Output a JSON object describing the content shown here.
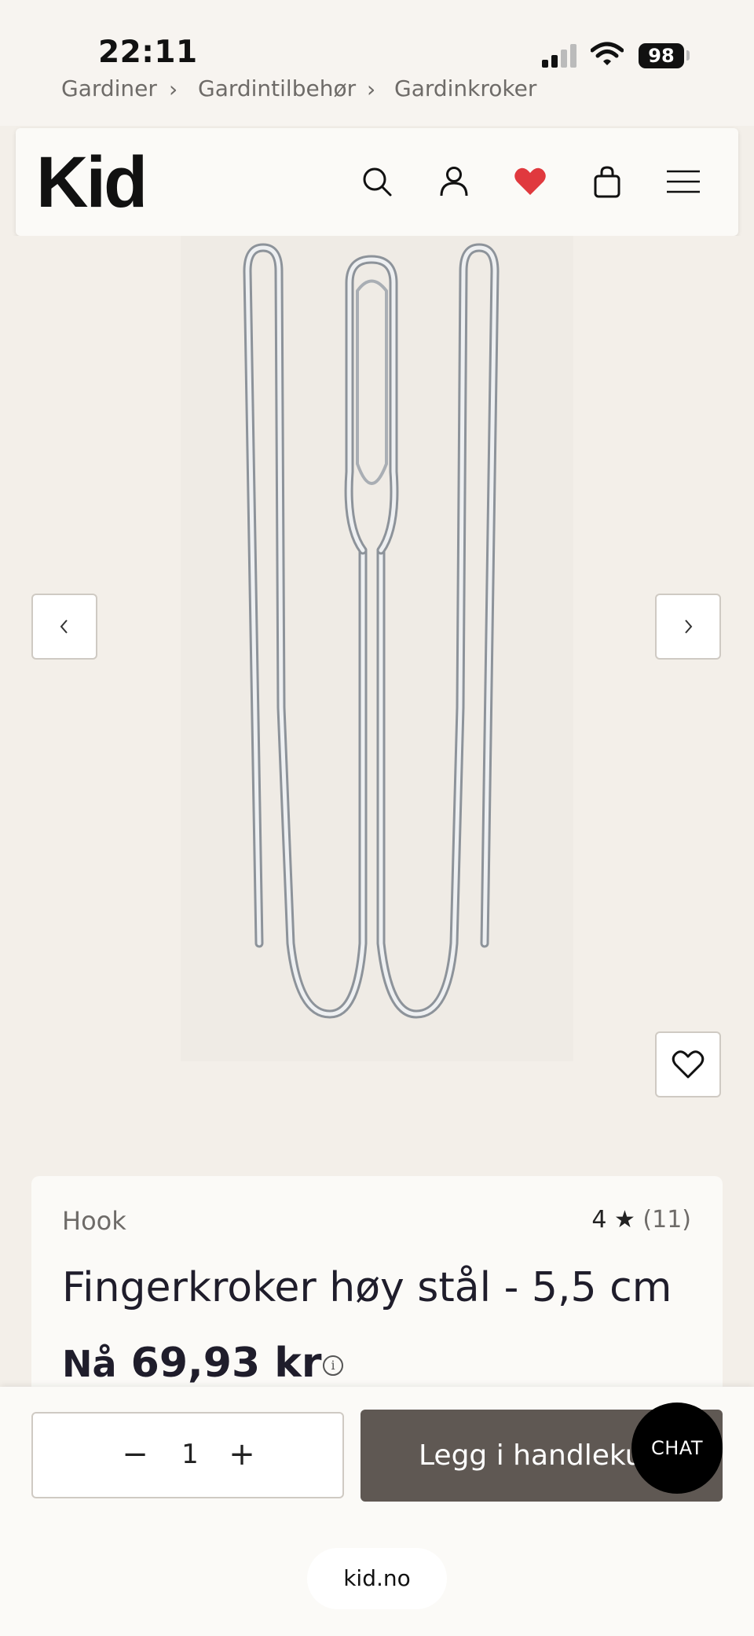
{
  "status_bar": {
    "time": "22:11",
    "battery": "98"
  },
  "breadcrumb": {
    "items": [
      "Gardiner",
      "Gardintilbehør",
      "Gardinkroker"
    ],
    "separator": "›"
  },
  "header": {
    "logo": "Kid",
    "icons": [
      "search-icon",
      "account-icon",
      "heart-icon",
      "bag-icon",
      "menu-icon"
    ],
    "heart_color": "#e0393e"
  },
  "gallery": {
    "prev_icon": "‹",
    "next_icon": "›"
  },
  "product": {
    "brand": "Hook",
    "rating": "4 ★",
    "rating_count": "(11)",
    "title": "Fingerkroker høy stål - 5,5 cm",
    "price_prefix": "Nå",
    "price": "69,93 kr",
    "info_icon": "i"
  },
  "cart": {
    "minus": "−",
    "quantity": "1",
    "plus": "+",
    "add_label": "Legg i handlekurv"
  },
  "chat": {
    "label": "CHAT"
  },
  "browser": {
    "url": "kid.no"
  },
  "colors": {
    "accent": "#5f5853",
    "background": "#f3efe9"
  }
}
